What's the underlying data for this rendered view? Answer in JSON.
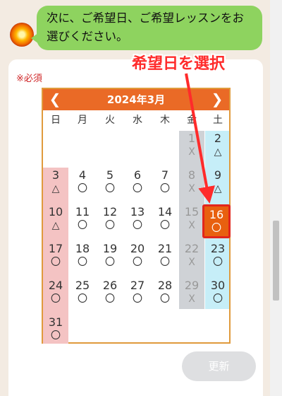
{
  "chat": {
    "message": "次に、ご希望日、ご希望レッスンをお選びください。"
  },
  "form": {
    "required_label": "※必須",
    "update_button": "更新"
  },
  "calendar": {
    "title": "2024年3月",
    "prev_icon": "chevron-left-icon",
    "next_icon": "chevron-right-icon",
    "weekdays": [
      "日",
      "月",
      "火",
      "水",
      "木",
      "金",
      "土"
    ],
    "first_weekday_index": 5,
    "days": [
      {
        "day": "1",
        "mark": "X",
        "past": true
      },
      {
        "day": "2",
        "mark": "△",
        "past": false
      },
      {
        "day": "3",
        "mark": "△",
        "past": false
      },
      {
        "day": "4",
        "mark": "〇",
        "past": false
      },
      {
        "day": "5",
        "mark": "〇",
        "past": false
      },
      {
        "day": "6",
        "mark": "〇",
        "past": false
      },
      {
        "day": "7",
        "mark": "〇",
        "past": false
      },
      {
        "day": "8",
        "mark": "X",
        "past": true
      },
      {
        "day": "9",
        "mark": "△",
        "past": false
      },
      {
        "day": "10",
        "mark": "△",
        "past": false
      },
      {
        "day": "11",
        "mark": "〇",
        "past": false
      },
      {
        "day": "12",
        "mark": "〇",
        "past": false
      },
      {
        "day": "13",
        "mark": "〇",
        "past": false
      },
      {
        "day": "14",
        "mark": "〇",
        "past": false
      },
      {
        "day": "15",
        "mark": "X",
        "past": true
      },
      {
        "day": "16",
        "mark": "〇",
        "past": false,
        "selected": true
      },
      {
        "day": "17",
        "mark": "〇",
        "past": false
      },
      {
        "day": "18",
        "mark": "〇",
        "past": false
      },
      {
        "day": "19",
        "mark": "〇",
        "past": false
      },
      {
        "day": "20",
        "mark": "〇",
        "past": false
      },
      {
        "day": "21",
        "mark": "〇",
        "past": false
      },
      {
        "day": "22",
        "mark": "X",
        "past": true
      },
      {
        "day": "23",
        "mark": "〇",
        "past": false
      },
      {
        "day": "24",
        "mark": "〇",
        "past": false
      },
      {
        "day": "25",
        "mark": "〇",
        "past": false
      },
      {
        "day": "26",
        "mark": "〇",
        "past": false
      },
      {
        "day": "27",
        "mark": "〇",
        "past": false
      },
      {
        "day": "28",
        "mark": "〇",
        "past": false
      },
      {
        "day": "29",
        "mark": "X",
        "past": true
      },
      {
        "day": "30",
        "mark": "〇",
        "past": false
      },
      {
        "day": "31",
        "mark": "〇",
        "past": false
      }
    ]
  },
  "annotation": {
    "text": "希望日を選択"
  },
  "colors": {
    "bubble": "#8ed35f",
    "calendar_header": "#ea6a26",
    "sunday_bg": "#f4c3c3",
    "saturday_bg": "#c6eef8",
    "friday_bg": "#cfd2d6",
    "selected_day": "#e8600f",
    "annotation": "#ff2b2b"
  }
}
